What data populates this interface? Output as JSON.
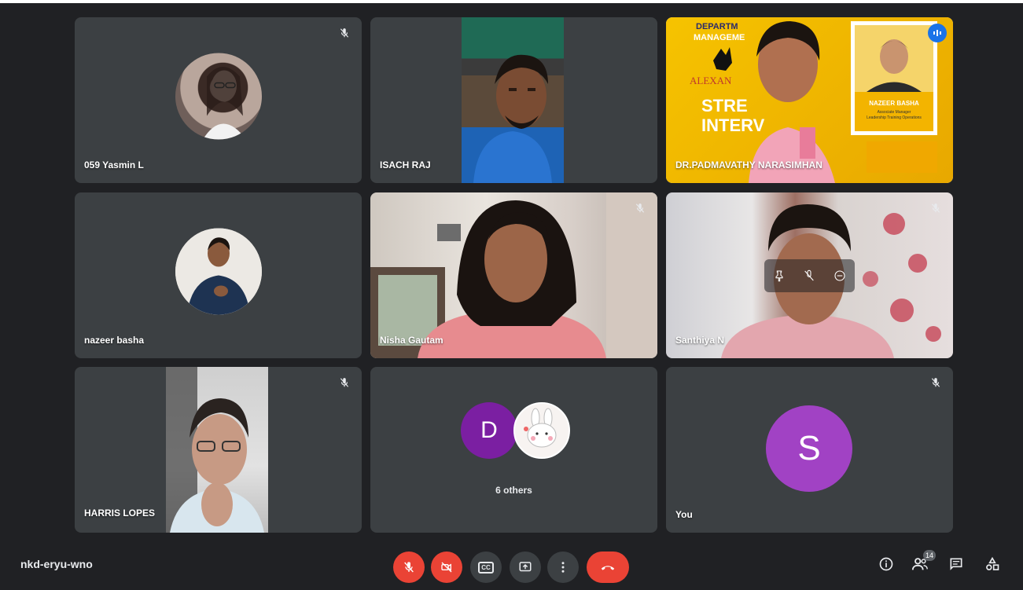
{
  "participants": [
    {
      "name": "059 Yasmin L",
      "muted": true
    },
    {
      "name": "ISACH RAJ",
      "muted": false
    },
    {
      "name": "DR.PADMAVATHY NARASIMHAN",
      "muted": false,
      "speaking": true
    },
    {
      "name": "nazeer basha",
      "muted": false
    },
    {
      "name": "Nisha Gautam",
      "muted": true
    },
    {
      "name": "Santhiya N",
      "muted": true
    },
    {
      "name": "HARRIS LOPES",
      "muted": true
    },
    {
      "name": "6 others",
      "muted": false,
      "avatar_letter": "D",
      "avatar_color": "#7b1fa2"
    },
    {
      "name": "You",
      "muted": true,
      "avatar_letter": "S",
      "avatar_color": "#a142c4"
    }
  ],
  "slide": {
    "line1": "DEPARTM",
    "line2": "MANAGEME",
    "brand": "ALEXAN",
    "title1": "STRE",
    "title2": "INTERV",
    "card_name": "NAZEER BASHA",
    "card_role1": "Associate Manager",
    "card_role2": "Leadership Training Operations"
  },
  "meeting": {
    "code": "nkd-eryu-wno",
    "people_count": "14"
  },
  "controls": {
    "mic": "mic-off-icon",
    "camera": "camera-off-icon",
    "captions": "CC",
    "present": "present-icon",
    "more": "more-icon",
    "leave": "leave-call-icon"
  },
  "colors": {
    "background": "#202124",
    "tile": "#3c4043",
    "red": "#ea4335",
    "speaking_outline": "#8ab4f8"
  }
}
